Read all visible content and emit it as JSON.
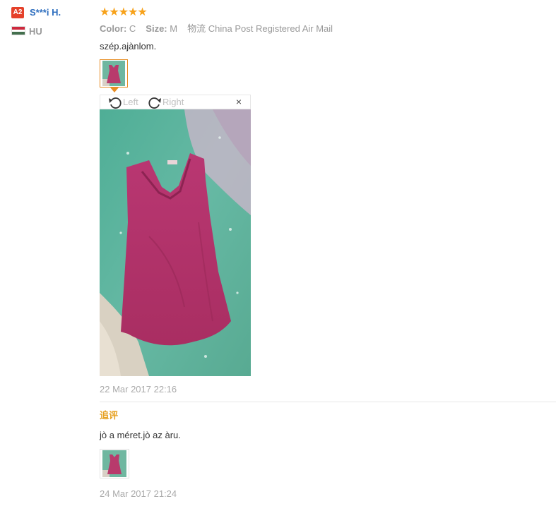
{
  "reviewer": {
    "badge": "A2",
    "name": "S***i H.",
    "country": "HU",
    "flag_colors": [
      "#cd2a3e",
      "#ffffff",
      "#436f4d"
    ]
  },
  "review": {
    "rating": 5,
    "stars": "★★★★★",
    "star_color": "#f7a21b",
    "color_label": "Color:",
    "color_value": "C",
    "size_label": "Size:",
    "size_value": "M",
    "shipping_label": "物流",
    "shipping_value": "China Post Registered Air Mail",
    "text": "szép.ajànlom.",
    "date": "22 Mar 2017 22:16"
  },
  "viewer": {
    "rotate_left_label": "Left",
    "rotate_right_label": "Right",
    "close_glyph": "×"
  },
  "followup": {
    "title": "追评",
    "text": "jò a méret.jò az àru.",
    "date": "24 Mar 2017 21:24"
  },
  "colors": {
    "username": "#2f6fbf",
    "thumb_border_active": "#e88d24",
    "followup_title": "#e6a122"
  }
}
